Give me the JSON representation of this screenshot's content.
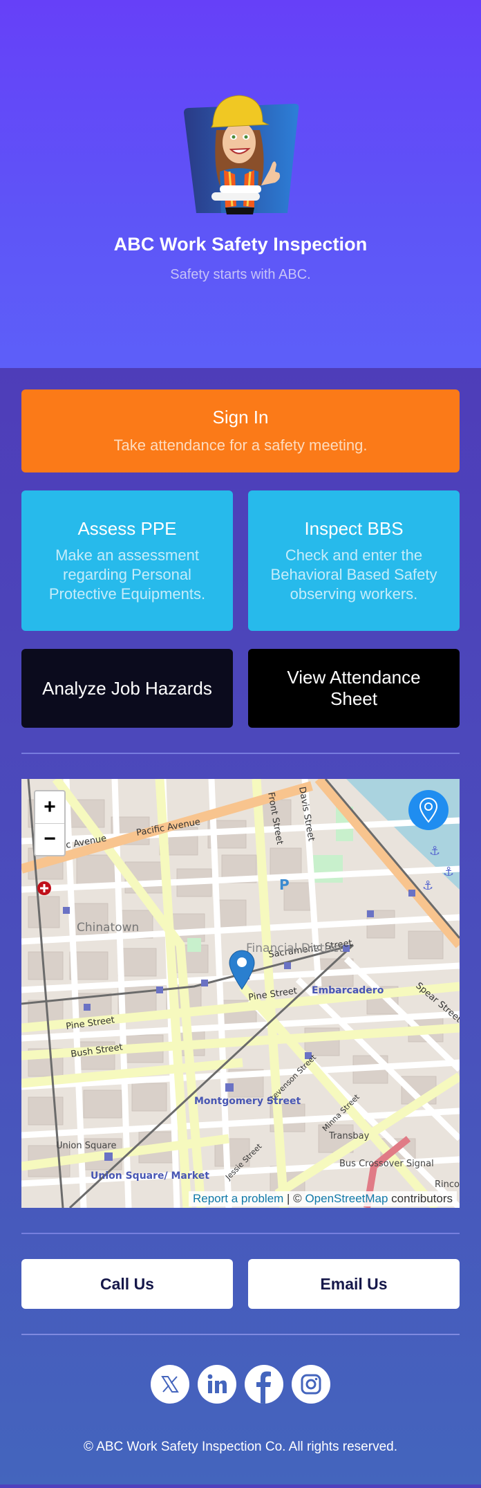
{
  "hero": {
    "logo_alt": "construction-worker-mascot",
    "title": "ABC Work Safety Inspection",
    "subtitle": "Safety starts with ABC."
  },
  "actions": {
    "sign_in": {
      "title": "Sign In",
      "description": "Take attendance for a safety meeting."
    },
    "assess_ppe": {
      "title": "Assess PPE",
      "description": "Make an assessment regarding Personal Protective Equipments."
    },
    "inspect_bbs": {
      "title": "Inspect BBS",
      "description": "Check and enter the Behavioral Based Safety observing workers."
    },
    "analyze_job_hazards": {
      "label": "Analyze Job Hazards"
    },
    "view_attendance_sheet": {
      "label": "View Attendance Sheet"
    }
  },
  "map": {
    "zoom_in_label": "+",
    "zoom_out_label": "−",
    "locate_icon": "location-pin-icon",
    "marker_icon": "map-marker-icon",
    "labels": {
      "pacific_avenue_1": "Pacific Avenue",
      "pacific_avenue_2": "c Avenue",
      "front_street": "Front Street",
      "davis_street": "Davis Street",
      "chinatown": "Chinatown",
      "sacramento_street": "Sacramento Street",
      "financial_district": "Financial District",
      "pine_street_1": "Pine Street",
      "pine_street_2": "Pine Street",
      "bush_street": "Bush Street",
      "embarcadero": "Embarcadero",
      "spear_street": "Spear Street",
      "stevenson_street": "Stevenson Street",
      "montgomery_street": "Montgomery Street",
      "minna_street": "Minna Street",
      "transbay": "Transbay",
      "union_square": "Union Square",
      "union_square_market": "Union Square/ Market",
      "jessie_street": "Jessie Street",
      "bus_crossover_signal": "Bus Crossover Signal",
      "rincon": "Rinco",
      "parking": "P"
    },
    "attribution": {
      "report": "Report a problem",
      "separator": " | © ",
      "osm": "OpenStreetMap",
      "contributors": " contributors"
    }
  },
  "contact": {
    "call_label": "Call Us",
    "email_label": "Email Us"
  },
  "social": [
    {
      "name": "x-icon",
      "label": "X"
    },
    {
      "name": "linkedin-icon",
      "label": "LinkedIn"
    },
    {
      "name": "facebook-icon",
      "label": "Facebook"
    },
    {
      "name": "instagram-icon",
      "label": "Instagram"
    }
  ],
  "footer": {
    "copyright": "© ABC Work Safety Inspection Co. All rights reserved."
  },
  "colors": {
    "hero_top": "#6640f8",
    "hero_bottom": "#5d5ff9",
    "sign_in": "#fb7a18",
    "card_blue": "#27baeb",
    "card_dark": "#0b0b1d",
    "card_black": "#000000",
    "locate_button": "#1f8df0",
    "contact_text": "#16184a"
  }
}
